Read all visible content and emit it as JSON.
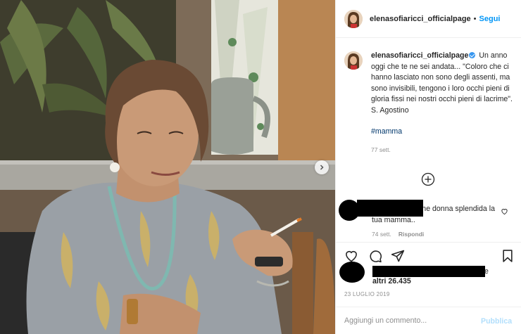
{
  "header": {
    "username": "elenasofiaricci_officialpage",
    "separator": "•",
    "follow_label": "Segui"
  },
  "caption": {
    "username": "elenasofiaricci_officialpage",
    "text": "Un anno oggi che te ne sei andata... \"Coloro che ci hanno lasciato non sono degli assenti, ma sono invisibili, tengono i loro occhi pieni di gloria fissi nei nostri occhi pieni di lacrime\". S. Agostino",
    "hashtag": "#mamma",
    "time": "77 sett."
  },
  "comment": {
    "text": "che donna splendida la tua mamma..",
    "time": "74 sett.",
    "reply_label": "Rispondi"
  },
  "likes": {
    "prefix_e": "e",
    "count_text": "altri 26.435"
  },
  "date": "23 LUGLIO 2019",
  "add_comment": {
    "placeholder": "Aggiungi un commento...",
    "publish_label": "Pubblica"
  },
  "colors": {
    "link": "#0095f6",
    "verified": "#3897f0",
    "hashtag": "#00376b",
    "muted": "#8e8e8e",
    "publish_disabled": "#b2dffc"
  },
  "icons": [
    "chevron-right-icon",
    "verified-badge-icon",
    "add-circle-icon",
    "heart-icon",
    "comment-icon",
    "share-icon",
    "bookmark-icon"
  ]
}
